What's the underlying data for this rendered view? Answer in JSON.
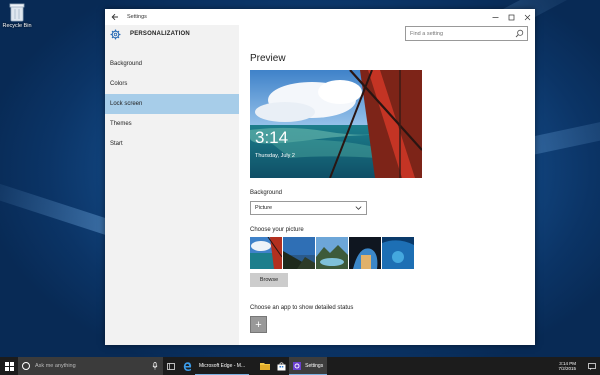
{
  "desktop": {
    "recycle_bin_label": "Recycle Bin"
  },
  "window": {
    "title": "Settings",
    "back_icon": "back-arrow-icon",
    "controls": [
      "minimize-icon",
      "maximize-icon",
      "close-icon"
    ]
  },
  "sidebar": {
    "header": "PERSONALIZATION",
    "items": [
      {
        "label": "Background",
        "selected": false
      },
      {
        "label": "Colors",
        "selected": false
      },
      {
        "label": "Lock screen",
        "selected": true
      },
      {
        "label": "Themes",
        "selected": false
      },
      {
        "label": "Start",
        "selected": false
      }
    ]
  },
  "search": {
    "placeholder": "Find a setting"
  },
  "main": {
    "preview_heading": "Preview",
    "preview_time": "3:14",
    "preview_date": "Thursday, July 2",
    "background_label": "Background",
    "background_value": "Picture",
    "choose_picture_label": "Choose your picture",
    "browse_label": "Browse",
    "choose_app_label": "Choose an app to show detailed status",
    "add_app_glyph": "+"
  },
  "taskbar": {
    "search_placeholder": "Ask me anything",
    "tasks": [
      {
        "label": "Microsoft Edge - M...",
        "active": false
      },
      {
        "label": "Settings",
        "active": true
      }
    ],
    "clock_time": "3:14 PM",
    "clock_date": "7/2/2015"
  },
  "colors": {
    "selected_nav": "#a7cde9",
    "taskbar": "#1c1c1c",
    "accent": "#7ab0e0"
  }
}
